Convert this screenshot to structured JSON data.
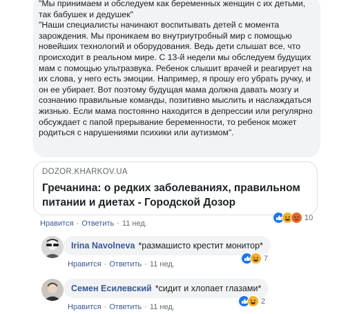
{
  "comment": {
    "paragraphs": [
      "\"Мы принимаем и обследуем как беременных женщин с их детьми, так бабушек и дедушек\"",
      "\"Наши специалисты начинают воспитывать детей с момента зарождения. Мы проникаем во внутриутробный мир с помощью новейших технологий и оборудования. Ведь дети слышат все, что происходит в реальном мире. С 13-й недели мы обследуем будущих мам с помощью ультразвука. Ребенок слышит врачей и реагирует на их слова, у него есть эмоции. Например, я прошу его убрать ручку, и он ее убирает. Вот поэтому будущая мама должна давать мозгу и сознанию правильные команды, позитивно мыслить и наслаждаться жизнью. Если мама постоянно находится в депрессии или регулярно обсуждает с папой прерывание беременности, то ребенок может родиться с нарушениями психики или аутизмом\"."
    ],
    "link": {
      "domain": "DOZOR.KHARKOV.UA",
      "title": "Гречанина: о редких заболеваниях, правильном питании и диетах - Городской Дозор"
    },
    "reaction_count": "10",
    "like_label": "Нравится",
    "reply_label": "Ответить",
    "time": "11 нед."
  },
  "replies": [
    {
      "author": "Irina Navolneva",
      "text": "*размашисто крестит монитор*",
      "reaction_count": "7",
      "like_label": "Нравится",
      "reply_label": "Ответить",
      "time": "11 нед."
    },
    {
      "author": "Семен Есилевский",
      "text": "*сидит и хлопает глазами*",
      "reaction_count": "2",
      "like_label": "Нравится",
      "reply_label": "Ответить",
      "time": "11 нед."
    }
  ],
  "separator": "·",
  "colors": {
    "link_blue": "#385898",
    "meta_gray": "#616770",
    "bubble_bg": "#f2f3f5",
    "like_blue": "#1877f2",
    "haha_yellow": "#f7b125",
    "angry_orange": "#e2662a"
  }
}
